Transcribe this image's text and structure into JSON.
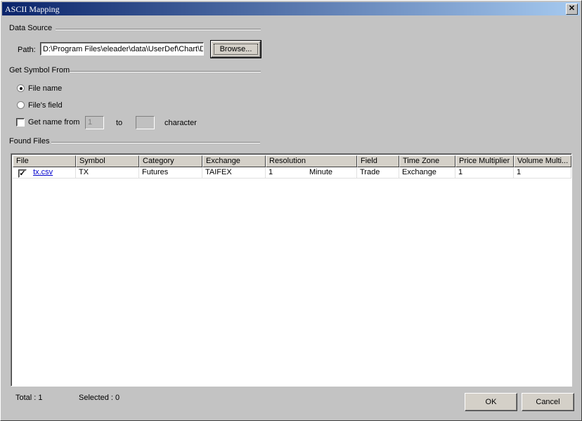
{
  "window": {
    "title": "ASCII Mapping",
    "close_glyph": "✕"
  },
  "data_source": {
    "group_label": "Data Source",
    "path_label": "Path:",
    "path_value": "D:\\Program Files\\eleader\\data\\UserDef\\Chart\\D",
    "browse_label": "Browse..."
  },
  "get_symbol": {
    "group_label": "Get Symbol From",
    "option_file_name": "File name",
    "option_file_field": "File's field",
    "option_get_name_from": "Get name from",
    "from_value": "1",
    "to_label": "to",
    "to_value": "",
    "character_label": "character",
    "selected": "File name"
  },
  "found_files": {
    "group_label": "Found Files",
    "columns": [
      "File",
      "Symbol",
      "Category",
      "Exchange",
      "Resolution",
      "Field",
      "Time Zone",
      "Price Multiplier",
      "Volume Multi..."
    ],
    "rows": [
      {
        "checked": true,
        "file": "tx.csv",
        "symbol": "TX",
        "category": "Futures",
        "exchange": "TAIFEX",
        "resolution_value": "1",
        "resolution_unit": "Minute",
        "field": "Trade",
        "time_zone": "Exchange",
        "price_multiplier": "1",
        "volume_multiplier": "1"
      }
    ]
  },
  "status": {
    "total": "Total : 1",
    "selected": "Selected : 0"
  },
  "buttons": {
    "ok": "OK",
    "cancel": "Cancel"
  },
  "colors": {
    "titlebar_start": "#0a246a",
    "titlebar_end": "#a6caf0",
    "dialog_bg": "#c3c3c3",
    "link": "#0000cc"
  }
}
